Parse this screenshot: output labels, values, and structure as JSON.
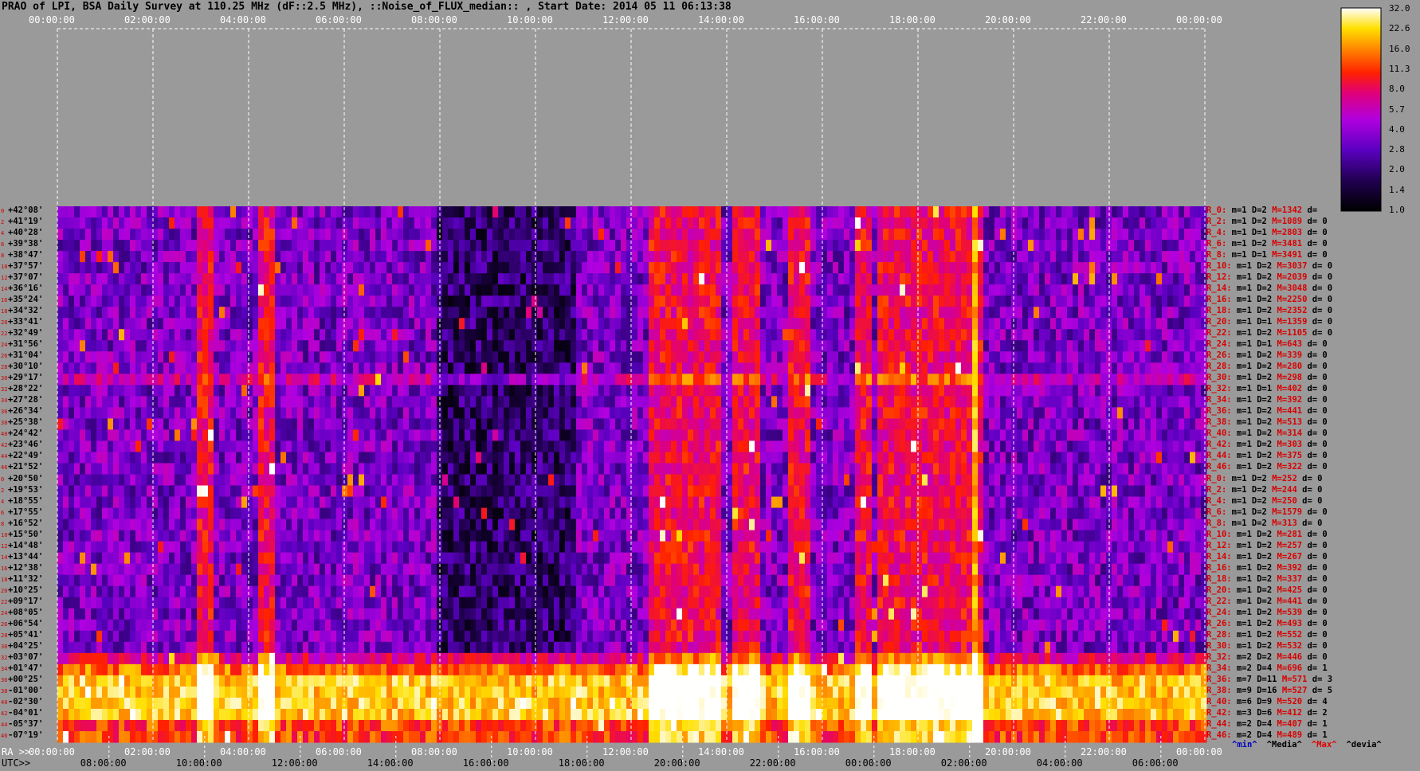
{
  "title": "PRAO of LPI, BSA Daily Survey at 110.25 MHz (dF::2.5 MHz), ::Noise_of_FLUX_median:: , Start Date: 2014 05 11 06:13:38",
  "top_ticks": [
    "00:00:00",
    "02:00:00",
    "04:00:00",
    "06:00:00",
    "08:00:00",
    "10:00:00",
    "12:00:00",
    "14:00:00",
    "16:00:00",
    "18:00:00",
    "20:00:00",
    "22:00:00",
    "00:00:00"
  ],
  "ra_label": "RA >>",
  "ra_ticks": [
    "00:00:00",
    "02:00:00",
    "04:00:00",
    "06:00:00",
    "08:00:00",
    "10:00:00",
    "12:00:00",
    "14:00:00",
    "16:00:00",
    "18:00:00",
    "20:00:00",
    "22:00:00",
    "00:00:00"
  ],
  "utc_label": "UTC>>",
  "utc_ticks": [
    "08:00:00",
    "10:00:00",
    "12:00:00",
    "14:00:00",
    "16:00:00",
    "18:00:00",
    "20:00:00",
    "22:00:00",
    "00:00:00",
    "02:00:00",
    "04:00:00",
    "06:00:00"
  ],
  "legend": [
    {
      "text": "^min^",
      "color": "#0000c0"
    },
    {
      "text": "^Media^",
      "color": "#000000"
    },
    {
      "text": "^Max^",
      "color": "#e00000"
    },
    {
      "text": "^devia^",
      "color": "#000000"
    }
  ],
  "chart_data": {
    "type": "heatmap",
    "title": "PRAO of LPI, BSA Daily Survey at 110.25 MHz (dF::2.5 MHz), ::Noise_of_FLUX_median:: , Start Date: 2014 05 11 06:13:38",
    "colorbar": {
      "ticks": [
        "32.0",
        "22.6",
        "16.0",
        "11.3",
        "8.0",
        "5.7",
        "4.0",
        "2.8",
        "2.0",
        "1.4",
        "1.0"
      ],
      "scale": "log",
      "range": [
        1.0,
        32.0
      ]
    },
    "declinations": [
      "+42°08'",
      "+41°19'",
      "+40°28'",
      "+39°38'",
      "+38°47'",
      "+37°57'",
      "+37°07'",
      "+36°16'",
      "+35°24'",
      "+34°32'",
      "+33°41'",
      "+32°49'",
      "+31°56'",
      "+31°04'",
      "+30°10'",
      "+29°17'",
      "+28°22'",
      "+27°28'",
      "+26°34'",
      "+25°38'",
      "+24°42'",
      "+23°46'",
      "+22°49'",
      "+21°52'",
      "+20°50'",
      "+19°53'",
      "+18°55'",
      "+17°55'",
      "+16°52'",
      "+15°50'",
      "+14°48'",
      "+13°44'",
      "+12°38'",
      "+11°32'",
      "+10°25'",
      "+09°17'",
      "+08°05'",
      "+06°54'",
      "+05°41'",
      "+04°25'",
      "+03°07'",
      "+01°47'",
      "+00°25'",
      "-01°00'",
      "-02°30'",
      "-04°01'",
      "-05°37'",
      "-07°19'"
    ],
    "row_index": [
      "0",
      "2",
      "4",
      "6",
      "8",
      "10",
      "12",
      "14",
      "16",
      "18",
      "20",
      "22",
      "24",
      "26",
      "28",
      "30",
      "32",
      "34",
      "36",
      "38",
      "40",
      "42",
      "44",
      "46",
      "0",
      "2",
      "4",
      "6",
      "8",
      "10",
      "12",
      "14",
      "16",
      "18",
      "20",
      "22",
      "24",
      "26",
      "28",
      "30",
      "32",
      "34",
      "36",
      "38",
      "40",
      "42",
      "44",
      "46"
    ],
    "beam_stats": [
      {
        "r": "R_0:",
        "m": "m=1",
        "D": "D=2",
        "M": "M=1342",
        "d": "d="
      },
      {
        "r": "R_2:",
        "m": "m=1",
        "D": "D=2",
        "M": "M=1089",
        "d": "d= 0"
      },
      {
        "r": "R_4:",
        "m": "m=1",
        "D": "D=1",
        "M": "M=2803",
        "d": "d= 0"
      },
      {
        "r": "R_6:",
        "m": "m=1",
        "D": "D=2",
        "M": "M=3481",
        "d": "d= 0"
      },
      {
        "r": "R_8:",
        "m": "m=1",
        "D": "D=1",
        "M": "M=3491",
        "d": "d= 0"
      },
      {
        "r": "R_10:",
        "m": "m=1",
        "D": "D=2",
        "M": "M=3037",
        "d": "d= 0"
      },
      {
        "r": "R_12:",
        "m": "m=1",
        "D": "D=2",
        "M": "M=2039",
        "d": "d= 0"
      },
      {
        "r": "R_14:",
        "m": "m=1",
        "D": "D=2",
        "M": "M=3048",
        "d": "d= 0"
      },
      {
        "r": "R_16:",
        "m": "m=1",
        "D": "D=2",
        "M": "M=2250",
        "d": "d= 0"
      },
      {
        "r": "R_18:",
        "m": "m=1",
        "D": "D=2",
        "M": "M=2352",
        "d": "d= 0"
      },
      {
        "r": "R_20:",
        "m": "m=1",
        "D": "D=1",
        "M": "M=1359",
        "d": "d= 0"
      },
      {
        "r": "R_22:",
        "m": "m=1",
        "D": "D=2",
        "M": "M=1105",
        "d": "d= 0"
      },
      {
        "r": "R_24:",
        "m": "m=1",
        "D": "D=1",
        "M": "M=643",
        "d": "d= 0"
      },
      {
        "r": "R_26:",
        "m": "m=1",
        "D": "D=2",
        "M": "M=339",
        "d": "d= 0"
      },
      {
        "r": "R_28:",
        "m": "m=1",
        "D": "D=2",
        "M": "M=280",
        "d": "d= 0"
      },
      {
        "r": "R_30:",
        "m": "m=1",
        "D": "D=2",
        "M": "M=298",
        "d": "d= 0"
      },
      {
        "r": "R_32:",
        "m": "m=1",
        "D": "D=1",
        "M": "M=402",
        "d": "d= 0"
      },
      {
        "r": "R_34:",
        "m": "m=1",
        "D": "D=2",
        "M": "M=392",
        "d": "d= 0"
      },
      {
        "r": "R_36:",
        "m": "m=1",
        "D": "D=2",
        "M": "M=441",
        "d": "d= 0"
      },
      {
        "r": "R_38:",
        "m": "m=1",
        "D": "D=2",
        "M": "M=513",
        "d": "d= 0"
      },
      {
        "r": "R_40:",
        "m": "m=1",
        "D": "D=2",
        "M": "M=314",
        "d": "d= 0"
      },
      {
        "r": "R_42:",
        "m": "m=1",
        "D": "D=2",
        "M": "M=303",
        "d": "d= 0"
      },
      {
        "r": "R_44:",
        "m": "m=1",
        "D": "D=2",
        "M": "M=375",
        "d": "d= 0"
      },
      {
        "r": "R_46:",
        "m": "m=1",
        "D": "D=2",
        "M": "M=322",
        "d": "d= 0"
      },
      {
        "r": "R_0:",
        "m": "m=1",
        "D": "D=2",
        "M": "M=252",
        "d": "d= 0"
      },
      {
        "r": "R_2:",
        "m": "m=1",
        "D": "D=2",
        "M": "M=244",
        "d": "d= 0"
      },
      {
        "r": "R_4:",
        "m": "m=1",
        "D": "D=2",
        "M": "M=250",
        "d": "d= 0"
      },
      {
        "r": "R_6:",
        "m": "m=1",
        "D": "D=2",
        "M": "M=1579",
        "d": "d= 0"
      },
      {
        "r": "R_8:",
        "m": "m=1",
        "D": "D=2",
        "M": "M=313",
        "d": "d= 0"
      },
      {
        "r": "R_10:",
        "m": "m=1",
        "D": "D=2",
        "M": "M=281",
        "d": "d= 0"
      },
      {
        "r": "R_12:",
        "m": "m=1",
        "D": "D=2",
        "M": "M=257",
        "d": "d= 0"
      },
      {
        "r": "R_14:",
        "m": "m=1",
        "D": "D=2",
        "M": "M=267",
        "d": "d= 0"
      },
      {
        "r": "R_16:",
        "m": "m=1",
        "D": "D=2",
        "M": "M=392",
        "d": "d= 0"
      },
      {
        "r": "R_18:",
        "m": "m=1",
        "D": "D=2",
        "M": "M=337",
        "d": "d= 0"
      },
      {
        "r": "R_20:",
        "m": "m=1",
        "D": "D=2",
        "M": "M=425",
        "d": "d= 0"
      },
      {
        "r": "R_22:",
        "m": "m=1",
        "D": "D=2",
        "M": "M=441",
        "d": "d= 0"
      },
      {
        "r": "R_24:",
        "m": "m=1",
        "D": "D=2",
        "M": "M=539",
        "d": "d= 0"
      },
      {
        "r": "R_26:",
        "m": "m=1",
        "D": "D=2",
        "M": "M=493",
        "d": "d= 0"
      },
      {
        "r": "R_28:",
        "m": "m=1",
        "D": "D=2",
        "M": "M=552",
        "d": "d= 0"
      },
      {
        "r": "R_30:",
        "m": "m=1",
        "D": "D=2",
        "M": "M=532",
        "d": "d= 0"
      },
      {
        "r": "R_32:",
        "m": "m=2",
        "D": "D=2",
        "M": "M=446",
        "d": "d= 0"
      },
      {
        "r": "R_34:",
        "m": "m=2",
        "D": "D=4",
        "M": "M=696",
        "d": "d= 1"
      },
      {
        "r": "R_36:",
        "m": "m=7",
        "D": "D=11",
        "M": "M=571",
        "d": "d= 3"
      },
      {
        "r": "R_38:",
        "m": "m=9",
        "D": "D=16",
        "M": "M=527",
        "d": "d= 5"
      },
      {
        "r": "R_40:",
        "m": "m=6",
        "D": "D=9",
        "M": "M=520",
        "d": "d= 4"
      },
      {
        "r": "R_42:",
        "m": "m=3",
        "D": "D=6",
        "M": "M=412",
        "d": "d= 2"
      },
      {
        "r": "R_44:",
        "m": "m=2",
        "D": "D=4",
        "M": "M=407",
        "d": "d= 1"
      },
      {
        "r": "R_46:",
        "m": "m=2",
        "D": "D=4",
        "M": "M=489",
        "d": "d= 1"
      }
    ]
  }
}
